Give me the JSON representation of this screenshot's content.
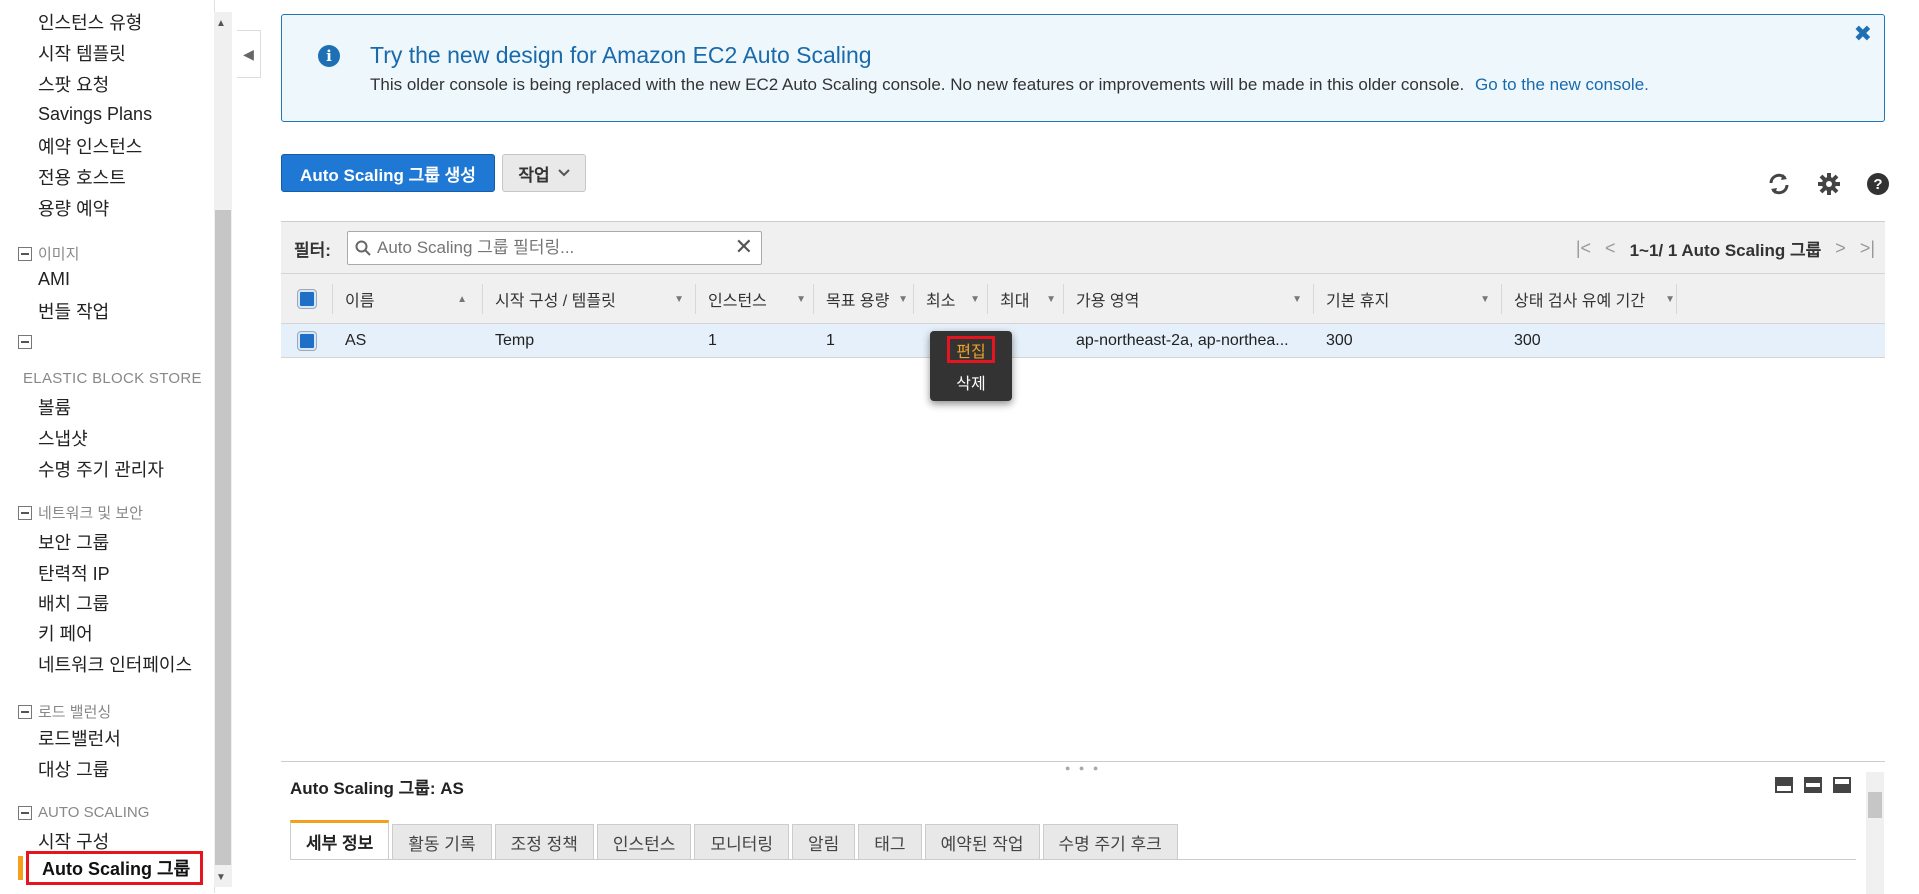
{
  "sidebar": {
    "items_top": [
      "인스턴스 유형",
      "시작 템플릿",
      "스팟 요청",
      "Savings Plans",
      "예약 인스턴스",
      "전용 호스트",
      "용량 예약"
    ],
    "sections": {
      "images": {
        "title": "이미지",
        "items": [
          "AMI",
          "번들 작업"
        ]
      },
      "ebs": {
        "title": "ELASTIC BLOCK STORE",
        "items": [
          "볼륨",
          "스냅샷",
          "수명 주기 관리자"
        ]
      },
      "network": {
        "title": "네트워크 및 보안",
        "items": [
          "보안 그룹",
          "탄력적 IP",
          "배치 그룹",
          "키 페어",
          "네트워크 인터페이스"
        ]
      },
      "lb": {
        "title": "로드 밸런싱",
        "items": [
          "로드밸런서",
          "대상 그룹"
        ]
      },
      "as": {
        "title": "AUTO SCALING",
        "items": [
          "시작 구성",
          "Auto Scaling 그룹"
        ]
      }
    }
  },
  "banner": {
    "title": "Try the new design for Amazon EC2 Auto Scaling",
    "text": "This older console is being replaced with the new EC2 Auto Scaling console. No new features or improvements will be made in this older console.",
    "link": "Go to the new console.",
    "close": "✖",
    "info_glyph": "i"
  },
  "toolbar": {
    "create_label": "Auto Scaling 그룹 생성",
    "action_label": "작업"
  },
  "filter": {
    "label": "필터:",
    "placeholder": "Auto Scaling 그룹 필터링...",
    "clear": "✕"
  },
  "pager": {
    "text": "1~1/ 1 Auto Scaling 그룹"
  },
  "table": {
    "columns": [
      "이름",
      "시작 구성 / 템플릿",
      "인스턴스",
      "목표 용량",
      "최소",
      "최대",
      "가용 영역",
      "기본 휴지",
      "상태 검사 유예 기간"
    ],
    "row": {
      "name": "AS",
      "launch_config": "Temp",
      "instances": "1",
      "desired": "1",
      "min": "",
      "max": "",
      "az": "ap-northeast-2a, ap-northea...",
      "cooldown": "300",
      "grace": "300"
    }
  },
  "context_menu": {
    "edit": "편집",
    "delete": "삭제"
  },
  "details": {
    "title": "Auto Scaling 그룹: AS",
    "tabs": [
      "세부 정보",
      "활동 기록",
      "조정 정책",
      "인스턴스",
      "모니터링",
      "알림",
      "태그",
      "예약된 작업",
      "수명 주기 후크"
    ]
  },
  "colors": {
    "accent": "#1e78d4",
    "highlight": "#e4151f",
    "active_tab": "#f59f1b"
  },
  "icons": [
    "info-icon",
    "close-icon",
    "refresh-icon",
    "gear-icon",
    "help-icon",
    "search-icon"
  ]
}
